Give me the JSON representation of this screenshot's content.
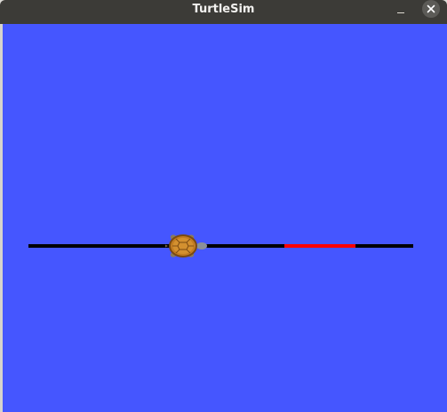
{
  "window": {
    "title": "TurtleSim"
  },
  "icons": {
    "minimize": "minimize-icon",
    "close": "close-icon",
    "turtle": "turtle-icon"
  },
  "colors": {
    "titlebar": "#3c3b37",
    "title_text": "#f2f1ef",
    "canvas_background": "#4556ff",
    "trail_default": "#000000",
    "trail_highlight": "#ff0000",
    "close_button": "#5c5b57"
  }
}
